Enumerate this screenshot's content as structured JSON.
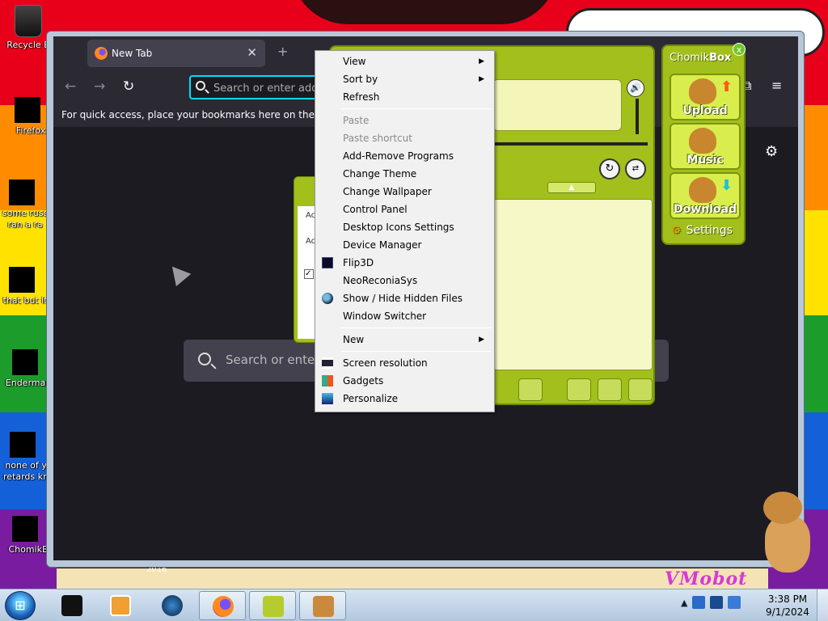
{
  "desktop": {
    "icons": [
      {
        "label": "Recycle B"
      },
      {
        "label": "Firefox"
      },
      {
        "label": "some russ ran a ra"
      },
      {
        "label": "that but it"
      },
      {
        "label": "Enderman"
      },
      {
        "label": "none of y retards kn"
      },
      {
        "label": "ChomikB"
      }
    ],
    "wallpaper_text": "VMobot",
    "year_text": "2016"
  },
  "browser": {
    "tab_title": "New Tab",
    "tab_close": "✕",
    "url_placeholder": "Search or enter add",
    "bookmarks_hint": "For quick access, place your bookmarks here on the bookm",
    "newtab_search_placeholder": "Search or enter a"
  },
  "window_controls": {
    "minimize": "–",
    "maximize": "□",
    "close": "✕"
  },
  "chomikbox": {
    "title_a": "Chomik",
    "title_b": "Box",
    "close": "x",
    "buttons": [
      "Upload",
      "Music",
      "Download"
    ],
    "settings_label": "Settings"
  },
  "small_panel": {
    "lines": [
      "Ac",
      "Ac"
    ]
  },
  "context_menu": {
    "groups": [
      [
        {
          "label": "View",
          "submenu": true,
          "disabled": false,
          "icon": ""
        },
        {
          "label": "Sort by",
          "submenu": true,
          "disabled": false,
          "icon": ""
        },
        {
          "label": "Refresh",
          "submenu": false,
          "disabled": false,
          "icon": ""
        }
      ],
      [
        {
          "label": "Paste",
          "submenu": false,
          "disabled": true,
          "icon": ""
        },
        {
          "label": "Paste shortcut",
          "submenu": false,
          "disabled": true,
          "icon": ""
        },
        {
          "label": "Add-Remove Programs",
          "submenu": false,
          "disabled": false,
          "icon": ""
        },
        {
          "label": "Change Theme",
          "submenu": false,
          "disabled": false,
          "icon": ""
        },
        {
          "label": "Change Wallpaper",
          "submenu": false,
          "disabled": false,
          "icon": ""
        },
        {
          "label": "Control Panel",
          "submenu": false,
          "disabled": false,
          "icon": ""
        },
        {
          "label": "Desktop Icons Settings",
          "submenu": false,
          "disabled": false,
          "icon": ""
        },
        {
          "label": "Device Manager",
          "submenu": false,
          "disabled": false,
          "icon": ""
        },
        {
          "label": "Flip3D",
          "submenu": false,
          "disabled": false,
          "icon": "flip3d-icon"
        },
        {
          "label": "NeoReconiaSys",
          "submenu": false,
          "disabled": false,
          "icon": ""
        },
        {
          "label": "Show / Hide Hidden Files",
          "submenu": false,
          "disabled": false,
          "icon": "globe-icon"
        },
        {
          "label": "Window Switcher",
          "submenu": false,
          "disabled": false,
          "icon": ""
        }
      ],
      [
        {
          "label": "New",
          "submenu": true,
          "disabled": false,
          "icon": ""
        }
      ],
      [
        {
          "label": "Screen resolution",
          "submenu": false,
          "disabled": false,
          "icon": "screen-icon"
        },
        {
          "label": "Gadgets",
          "submenu": false,
          "disabled": false,
          "icon": "gadgets-icon"
        },
        {
          "label": "Personalize",
          "submenu": false,
          "disabled": false,
          "icon": "personalize-icon"
        }
      ]
    ]
  },
  "taskbar": {
    "clock_time": "3:38 PM",
    "clock_date": "9/1/2024",
    "tray_arrow": "▲"
  },
  "colors": {
    "accent_focus": "#00ddff",
    "chomik_green": "#a3bf1c",
    "firefox_dark": "#1c1b22"
  }
}
